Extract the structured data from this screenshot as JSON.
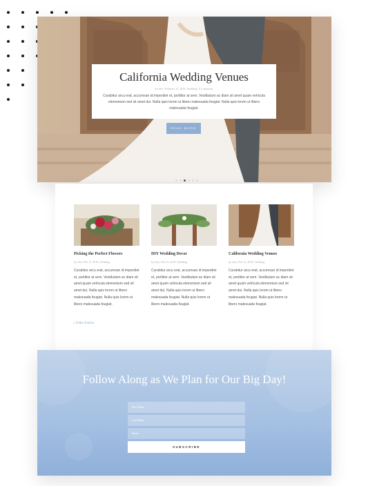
{
  "colors": {
    "accent": "#8eaed3",
    "signup_top": "#bcd0e8",
    "signup_bottom": "#8fb0da"
  },
  "hero": {
    "title": "California Wedding Venues",
    "meta": "by elee | February 12, 2018 | Wedding | 0 Comments",
    "text": "Curabitur arcu erat, accumsan id imperdiet et, porttitor at sem. Vestibulum ac diam sit amet quam vehicula elementum sed sit amet dui. Nulla quis lorem ut libero malesuada feugiat. Nulla quis lorem ut libero malesuada feugiat.",
    "button": "READ MORE",
    "slider_count": 6,
    "slider_active": 2
  },
  "posts": [
    {
      "title": "Picking the Perfect Flowers",
      "meta": "by elee | Feb 12, 2018 | Wedding",
      "text": "Curabitur arcu erat, accumsan id imperdiet et, porttitor at sem. Vestibulum ac diam sit amet quam vehicula elementum sed sit amet dui. Nulla quis lorem ut libero malesuada feugiat. Nulla quis lorem ut libero malesuada feugiat.",
      "image": "flowers-photo"
    },
    {
      "title": "DIY Wedding Decor",
      "meta": "by elee | Feb 12, 2018 | Wedding",
      "text": "Curabitur arcu erat, accumsan id imperdiet et, porttitor at sem. Vestibulum ac diam sit amet quam vehicula elementum sed sit amet dui. Nulla quis lorem ut libero malesuada feugiat. Nulla quis lorem ut libero malesuada feugiat.",
      "image": "decor-photo"
    },
    {
      "title": "California Wedding Venues",
      "meta": "by elee | Feb 12, 2018 | Wedding",
      "text": "Curabitur arcu erat, accumsan id imperdiet et, porttitor at sem. Vestibulum ac diam sit amet quam vehicula elementum sed sit amet dui. Nulla quis lorem ut libero malesuada feugiat. Nulla quis lorem ut libero malesuada feugiat.",
      "image": "couple-photo"
    }
  ],
  "older_entries": "« Older Entries",
  "signup": {
    "title": "Follow Along as We Plan for Our Big Day!",
    "first_name": "First Name",
    "last_name": "Last Name",
    "email": "Email",
    "button": "SUBSCRIBE"
  }
}
